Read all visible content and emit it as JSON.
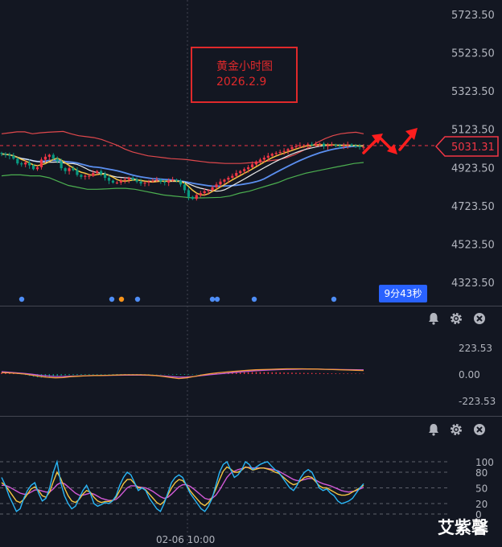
{
  "chart_data": [
    {
      "type": "candlestick",
      "title": "黄金小时图",
      "subtitle": "2026.2.9",
      "ylim": [
        4280,
        5760
      ],
      "y_ticks": [
        "5723.50",
        "5523.50",
        "5323.50",
        "5123.50",
        "4923.50",
        "4723.50",
        "4523.50",
        "4323.50"
      ],
      "last_price": "5031.31",
      "countdown": "9分43秒",
      "x_label": "02-06 10:00",
      "close": [
        4995,
        4990,
        4985,
        4970,
        4945,
        4940,
        4950,
        4935,
        4915,
        4925,
        4965,
        4980,
        4990,
        4970,
        4955,
        4920,
        4905,
        4920,
        4910,
        4885,
        4875,
        4880,
        4880,
        4895,
        4905,
        4890,
        4870,
        4855,
        4845,
        4845,
        4855,
        4860,
        4870,
        4860,
        4850,
        4840,
        4845,
        4850,
        4855,
        4860,
        4850,
        4845,
        4855,
        4860,
        4855,
        4835,
        4805,
        4770,
        4760,
        4780,
        4790,
        4800,
        4805,
        4820,
        4835,
        4850,
        4860,
        4870,
        4880,
        4895,
        4905,
        4915,
        4925,
        4940,
        4955,
        4965,
        4975,
        4985,
        4995,
        5000,
        5005,
        5010,
        5020,
        5030,
        5035,
        5040,
        5040,
        5045,
        5040,
        5045,
        5048,
        5035,
        5040,
        5042,
        5038,
        5035,
        5040,
        5044,
        5038,
        5035,
        5030,
        5031
      ],
      "upper_band": [
        5100,
        5105,
        5110,
        5110,
        5100,
        5105,
        5108,
        5110,
        5112,
        5100,
        5090,
        5085,
        5080,
        5070,
        5055,
        5040,
        5020,
        5005,
        4995,
        4985,
        4980,
        4975,
        4970,
        4968,
        4965,
        4960,
        4955,
        4950,
        4948,
        4945,
        4945,
        4945,
        4948,
        4950,
        4955,
        4960,
        4965,
        4975,
        4990,
        5010,
        5030,
        5055,
        5075,
        5090,
        5100,
        5105,
        5108,
        5100
      ],
      "lower_band": [
        4880,
        4885,
        4885,
        4880,
        4880,
        4870,
        4850,
        4830,
        4820,
        4810,
        4810,
        4812,
        4815,
        4815,
        4810,
        4800,
        4790,
        4780,
        4775,
        4770,
        4765,
        4765,
        4766,
        4768,
        4775,
        4790,
        4800,
        4815,
        4830,
        4845,
        4865,
        4880,
        4895,
        4905,
        4915,
        4925,
        4935,
        4945,
        4950
      ]
    },
    {
      "type": "bar",
      "name": "MACD",
      "y_ticks": [
        "223.53",
        "0.00",
        "-223.53"
      ],
      "hist": [
        12,
        10,
        8,
        6,
        3,
        -2,
        -8,
        -15,
        -22,
        -28,
        -30,
        -28,
        -25,
        -20,
        -15,
        -12,
        -10,
        -9,
        -8,
        -8,
        -7,
        -6,
        -6,
        -5,
        -5,
        -5,
        -4,
        -4,
        -4,
        -4,
        -3,
        -3,
        -3,
        -3,
        -3,
        -3,
        -2,
        -2,
        -2,
        -2,
        -3,
        -3,
        -4,
        -5,
        -6,
        -6,
        -6,
        -5,
        -4,
        -3,
        -2,
        -1,
        2,
        4,
        6,
        8,
        10,
        12,
        14,
        15,
        16,
        16,
        16,
        17,
        17,
        17,
        16,
        16,
        15,
        15,
        14,
        13,
        12,
        12,
        11,
        10,
        10,
        9,
        9,
        8,
        8,
        7,
        7,
        6,
        6,
        5,
        5,
        5,
        4,
        4,
        3,
        3
      ],
      "macd": [
        12,
        10,
        6,
        0,
        -10,
        -20,
        -28,
        -32,
        -30,
        -22,
        -18,
        -14,
        -12,
        -12,
        -10,
        -8,
        -6,
        -6,
        -6,
        -8,
        -12,
        -20,
        -30,
        -38,
        -32,
        -20,
        -8,
        2,
        10,
        16,
        22,
        27,
        32,
        36,
        38,
        40,
        42,
        44,
        44,
        44,
        43,
        42,
        40,
        38,
        36,
        34,
        32,
        30
      ],
      "signal": [
        20,
        15,
        10,
        5,
        -2,
        -10,
        -16,
        -20,
        -20,
        -18,
        -16,
        -14,
        -13,
        -12,
        -11,
        -10,
        -9,
        -9,
        -9,
        -10,
        -12,
        -16,
        -22,
        -26,
        -25,
        -20,
        -13,
        -6,
        0,
        6,
        12,
        18,
        23,
        28,
        32,
        35,
        37,
        39,
        40,
        41,
        41,
        41,
        40,
        39,
        38,
        37,
        36,
        35
      ]
    },
    {
      "type": "line",
      "name": "KDJ",
      "y_ticks": [
        "100",
        "80",
        "50",
        "20",
        "0"
      ],
      "fast": [
        70,
        55,
        35,
        20,
        5,
        10,
        30,
        45,
        55,
        60,
        40,
        25,
        30,
        50,
        80,
        100,
        60,
        35,
        20,
        10,
        15,
        30,
        45,
        55,
        40,
        20,
        15,
        18,
        22,
        20,
        25,
        35,
        55,
        70,
        80,
        75,
        60,
        45,
        50,
        45,
        30,
        20,
        10,
        5,
        20,
        40,
        60,
        70,
        75,
        70,
        55,
        40,
        30,
        20,
        10,
        5,
        15,
        30,
        55,
        80,
        95,
        100,
        85,
        70,
        75,
        85,
        100,
        95,
        85,
        90,
        95,
        98,
        100,
        92,
        85,
        80,
        70,
        60,
        50,
        45,
        55,
        70,
        80,
        85,
        80,
        65,
        50,
        45,
        48,
        40,
        35,
        25,
        20,
        22,
        25,
        30,
        40,
        50,
        58
      ],
      "mid": [
        60,
        55,
        45,
        35,
        25,
        22,
        28,
        38,
        48,
        52,
        45,
        35,
        32,
        42,
        62,
        80,
        68,
        50,
        35,
        25,
        22,
        28,
        38,
        45,
        42,
        32,
        25,
        22,
        24,
        24,
        26,
        32,
        45,
        58,
        66,
        66,
        58,
        50,
        50,
        46,
        38,
        30,
        22,
        18,
        24,
        36,
        50,
        60,
        66,
        64,
        56,
        45,
        36,
        28,
        20,
        16,
        22,
        32,
        48,
        66,
        82,
        90,
        86,
        80,
        80,
        84,
        90,
        88,
        84,
        86,
        88,
        88,
        86,
        84,
        80,
        78,
        72,
        66,
        60,
        56,
        58,
        64,
        70,
        72,
        70,
        62,
        54,
        50,
        50,
        46,
        42,
        38,
        36,
        36,
        38,
        42,
        46,
        50,
        55
      ],
      "slow": [
        55,
        55,
        52,
        48,
        44,
        40,
        38,
        38,
        42,
        46,
        46,
        44,
        42,
        42,
        48,
        56,
        60,
        58,
        52,
        46,
        40,
        36,
        36,
        38,
        40,
        38,
        34,
        30,
        28,
        26,
        26,
        28,
        34,
        42,
        50,
        54,
        54,
        52,
        51,
        50,
        47,
        43,
        38,
        33,
        30,
        32,
        38,
        45,
        52,
        56,
        56,
        53,
        48,
        42,
        36,
        30,
        28,
        30,
        36,
        46,
        58,
        70,
        78,
        82,
        85,
        87,
        89,
        89,
        88,
        88,
        88,
        88,
        87,
        86,
        84,
        82,
        78,
        74,
        70,
        66,
        64,
        64,
        66,
        68,
        68,
        65,
        61,
        58,
        56,
        54,
        51,
        48,
        45,
        43,
        42,
        43,
        45,
        48,
        51
      ]
    }
  ],
  "watermark": "艾紫馨",
  "icons": [
    "bell-icon",
    "gear-icon",
    "close-icon"
  ],
  "colors": {
    "up": "#f23645",
    "down": "#089981",
    "ma_blue": "#5b8ff0",
    "ma_yellow": "#f5c542",
    "ma_white": "#e8e8e8",
    "band_red": "#e0484c",
    "band_green": "#4caf50",
    "arrow": "#ff1e1e"
  }
}
